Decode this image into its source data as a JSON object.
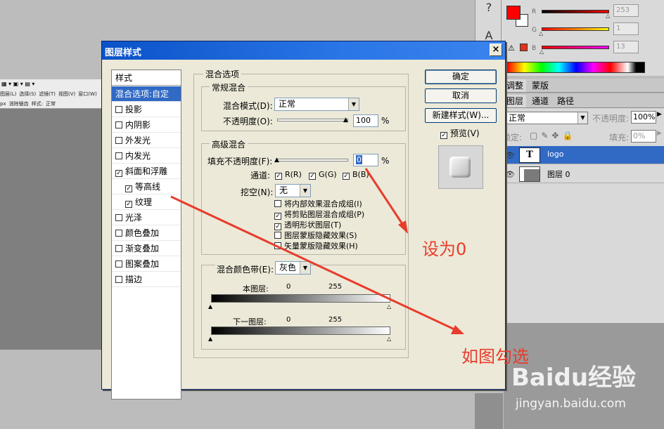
{
  "workspace": {
    "toolbar_rows": [
      [
        "图层(L)",
        "选择(S)",
        "滤镜(T)",
        "视图(V)",
        "窗口(W)"
      ],
      [
        "px",
        "消除锯齿",
        "样式:",
        "正常"
      ]
    ],
    "tools": [
      "?",
      "A"
    ]
  },
  "color_panel": {
    "channels": [
      {
        "label": "R",
        "value": "253",
        "color": "#fe0000"
      },
      {
        "label": "G",
        "value": "1",
        "color": "#ffff00"
      },
      {
        "label": "B",
        "value": "13",
        "color": "#ff00ff"
      }
    ],
    "warning_icon": "warning-triangle-icon"
  },
  "adjust_tabs": [
    "调整",
    "蒙版"
  ],
  "layers_tabs": [
    "图层",
    "通道",
    "路径"
  ],
  "layers_panel": {
    "blend_mode": "正常",
    "opacity_label": "不透明度:",
    "opacity_value": "100%",
    "lock_label": "锁定:",
    "fill_label": "填充:",
    "fill_value": "0%",
    "layers": [
      {
        "thumb": "T",
        "name": "logo",
        "selected": true
      },
      {
        "thumb": "",
        "name": "图层 0",
        "selected": false
      }
    ]
  },
  "dialog": {
    "title": "图层样式",
    "close_glyph": "×",
    "styles_header": "样式",
    "style_items": [
      {
        "label": "混合选项:自定",
        "checkbox": false,
        "checked": false,
        "sub": false,
        "selected": true
      },
      {
        "label": "投影",
        "checkbox": true,
        "checked": false,
        "sub": false,
        "selected": false
      },
      {
        "label": "内阴影",
        "checkbox": true,
        "checked": false,
        "sub": false,
        "selected": false
      },
      {
        "label": "外发光",
        "checkbox": true,
        "checked": false,
        "sub": false,
        "selected": false
      },
      {
        "label": "内发光",
        "checkbox": true,
        "checked": false,
        "sub": false,
        "selected": false
      },
      {
        "label": "斜面和浮雕",
        "checkbox": true,
        "checked": true,
        "sub": false,
        "selected": false
      },
      {
        "label": "等高线",
        "checkbox": true,
        "checked": true,
        "sub": true,
        "selected": false
      },
      {
        "label": "纹理",
        "checkbox": true,
        "checked": true,
        "sub": true,
        "selected": false
      },
      {
        "label": "光泽",
        "checkbox": true,
        "checked": false,
        "sub": false,
        "selected": false
      },
      {
        "label": "颜色叠加",
        "checkbox": true,
        "checked": false,
        "sub": false,
        "selected": false
      },
      {
        "label": "渐变叠加",
        "checkbox": true,
        "checked": false,
        "sub": false,
        "selected": false
      },
      {
        "label": "图案叠加",
        "checkbox": true,
        "checked": false,
        "sub": false,
        "selected": false
      },
      {
        "label": "描边",
        "checkbox": true,
        "checked": false,
        "sub": false,
        "selected": false
      }
    ],
    "blend_options_title": "混合选项",
    "general_title": "常规混合",
    "blend_mode_label": "混合模式(D):",
    "blend_mode_value": "正常",
    "opacity_label": "不透明度(O):",
    "opacity_value": "100",
    "percent": "%",
    "advanced_title": "高级混合",
    "fill_opacity_label": "填充不透明度(F):",
    "fill_opacity_value": "0",
    "channels_label": "通道:",
    "channels": [
      {
        "label": "R(R)",
        "checked": true
      },
      {
        "label": "G(G)",
        "checked": true
      },
      {
        "label": "B(B)",
        "checked": true
      }
    ],
    "knockout_label": "挖空(N):",
    "knockout_value": "无",
    "options": [
      {
        "label": "将内部效果混合成组(I)",
        "checked": false
      },
      {
        "label": "将剪贴图层混合成组(P)",
        "checked": true
      },
      {
        "label": "透明形状图层(T)",
        "checked": true
      },
      {
        "label": "图层蒙版隐藏效果(S)",
        "checked": false
      },
      {
        "label": "矢量蒙版隐藏效果(H)",
        "checked": false
      }
    ],
    "blend_if_label": "混合颜色带(E):",
    "blend_if_value": "灰色",
    "this_layer_label": "本图层:",
    "underlying_label": "下一图层:",
    "range_low": "0",
    "range_high": "255",
    "ok_label": "确定",
    "cancel_label": "取消",
    "new_style_label": "新建样式(W)...",
    "preview_label": "预览(V)",
    "preview_checked": true
  },
  "annotations": {
    "set_to_zero": "设为0",
    "check_as_shown": "如图勾选",
    "color": "#e83c2c"
  },
  "watermark": {
    "brand": "Baidu经验",
    "url": "jingyan.baidu.com"
  }
}
